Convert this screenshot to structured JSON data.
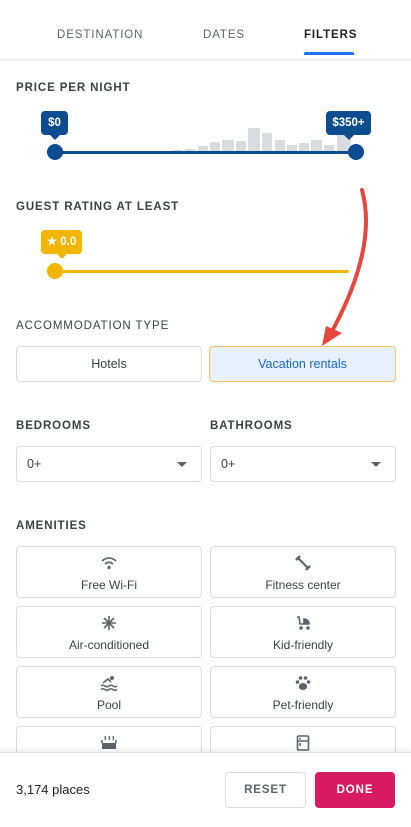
{
  "tabs": [
    {
      "label": "DESTINATION"
    },
    {
      "label": "DATES"
    },
    {
      "label": "FILTERS"
    }
  ],
  "accent_color": "#1a73e8",
  "price": {
    "title": "PRICE PER NIGHT",
    "min_label": "$0",
    "max_label": "$350+",
    "min_fraction": 0,
    "max_fraction": 1,
    "color": "#0d4c8f"
  },
  "rating": {
    "title": "GUEST RATING AT LEAST",
    "value_label": "★ 0.0",
    "fraction": 0,
    "color": "#f2b600"
  },
  "accommodation": {
    "title": "ACCOMMODATION TYPE",
    "options": [
      {
        "label": "Hotels",
        "selected": false
      },
      {
        "label": "Vacation rentals",
        "selected": true
      }
    ]
  },
  "bedrooms": {
    "title": "BEDROOMS",
    "value": "0+"
  },
  "bathrooms": {
    "title": "BATHROOMS",
    "value": "0+"
  },
  "amenities": {
    "title": "AMENITIES",
    "items": [
      {
        "label": "Free Wi-Fi",
        "icon": "wifi-icon"
      },
      {
        "label": "Fitness center",
        "icon": "dumbbell-icon"
      },
      {
        "label": "Air-conditioned",
        "icon": "snowflake-icon"
      },
      {
        "label": "Kid-friendly",
        "icon": "stroller-icon"
      },
      {
        "label": "Pool",
        "icon": "pool-icon"
      },
      {
        "label": "Pet-friendly",
        "icon": "paw-icon"
      },
      {
        "label": "",
        "icon": "spa-icon"
      },
      {
        "label": "",
        "icon": "kitchen-icon"
      }
    ]
  },
  "footer": {
    "count": "3,174 places",
    "reset_label": "RESET",
    "done_label": "DONE",
    "done_color": "#d81b60"
  },
  "annotation_color": "#e8453c"
}
